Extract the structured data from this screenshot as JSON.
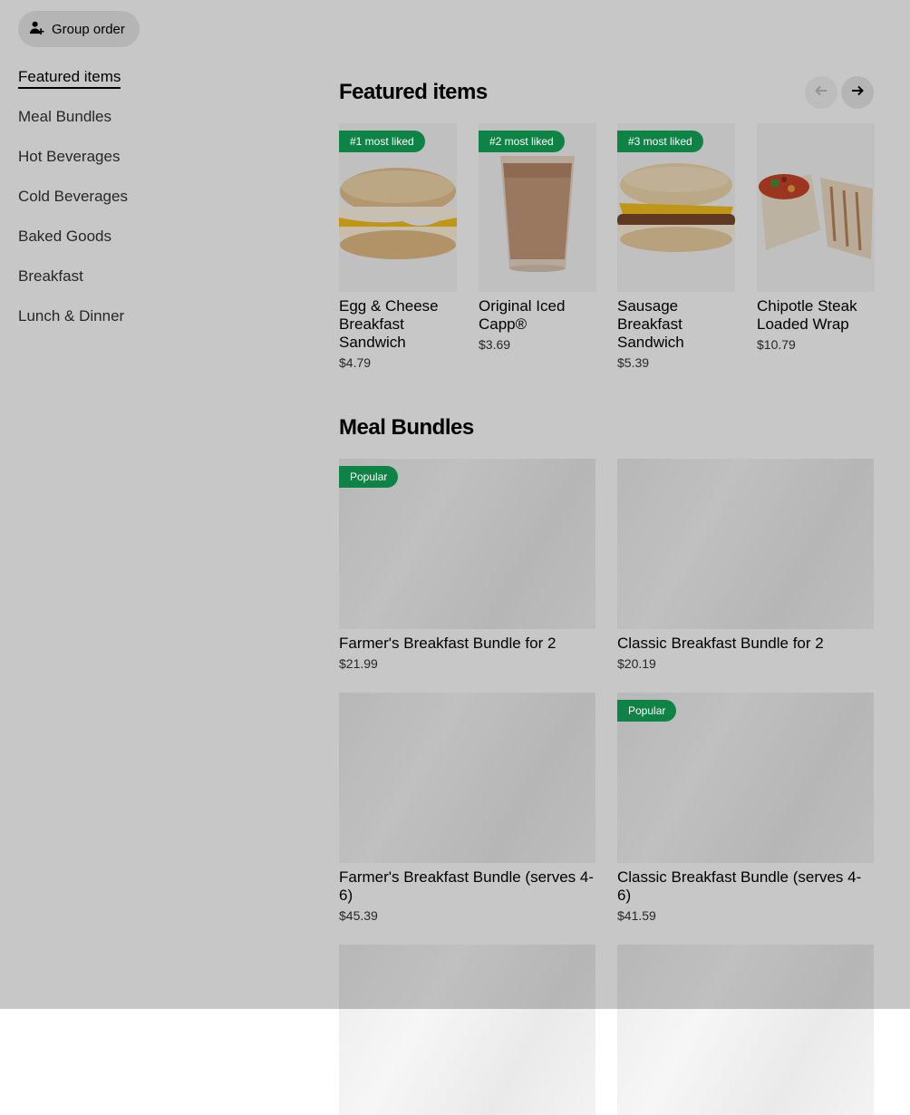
{
  "header": {
    "group_order_label": "Group order",
    "group_order_icon": "person-add-icon"
  },
  "sidebar": {
    "items": [
      {
        "label": "Featured items",
        "active": true
      },
      {
        "label": "Meal Bundles"
      },
      {
        "label": "Hot Beverages"
      },
      {
        "label": "Cold Beverages"
      },
      {
        "label": "Baked Goods"
      },
      {
        "label": "Breakfast"
      },
      {
        "label": "Lunch & Dinner"
      }
    ]
  },
  "featured": {
    "title": "Featured items",
    "prev_icon": "arrow-left-icon",
    "next_icon": "arrow-right-icon",
    "items": [
      {
        "badge": "#1 most liked",
        "name": "Egg & Cheese Breakfast Sandwich",
        "price": "$4.79"
      },
      {
        "badge": "#2 most liked",
        "name": "Original Iced Capp®",
        "price": "$3.69"
      },
      {
        "badge": "#3 most liked",
        "name": "Sausage Breakfast Sandwich",
        "price": "$5.39"
      },
      {
        "badge": "",
        "name": "Chipotle Steak Loaded Wrap",
        "price": "$10.79"
      }
    ]
  },
  "bundles": {
    "title": "Meal Bundles",
    "items": [
      {
        "badge": "Popular",
        "name": "Farmer's Breakfast Bundle for 2",
        "price": "$21.99"
      },
      {
        "badge": "",
        "name": "Classic Breakfast Bundle for 2",
        "price": "$20.19"
      },
      {
        "badge": "",
        "name": "Farmer's Breakfast Bundle (serves 4-6)",
        "price": "$45.39"
      },
      {
        "badge": "Popular",
        "name": "Classic Breakfast Bundle (serves 4-6)",
        "price": "$41.59"
      }
    ]
  },
  "colors": {
    "badge_green": "#0e8345",
    "overlay": "rgba(0,0,0,0.22)"
  }
}
